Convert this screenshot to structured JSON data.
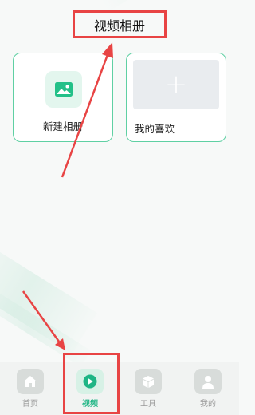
{
  "header": {
    "title": "视频相册"
  },
  "albums": {
    "new_album_label": "新建相册",
    "favorites_label": "我的喜欢"
  },
  "tabs": [
    {
      "label": "首页",
      "icon": "home-icon",
      "active": false
    },
    {
      "label": "视频",
      "icon": "play-icon",
      "active": true
    },
    {
      "label": "工具",
      "icon": "box-icon",
      "active": false
    },
    {
      "label": "我的",
      "icon": "user-icon",
      "active": false
    }
  ],
  "colors": {
    "accent": "#1fb585",
    "card_border": "#5fd0a3",
    "annotation": "#e84444"
  }
}
